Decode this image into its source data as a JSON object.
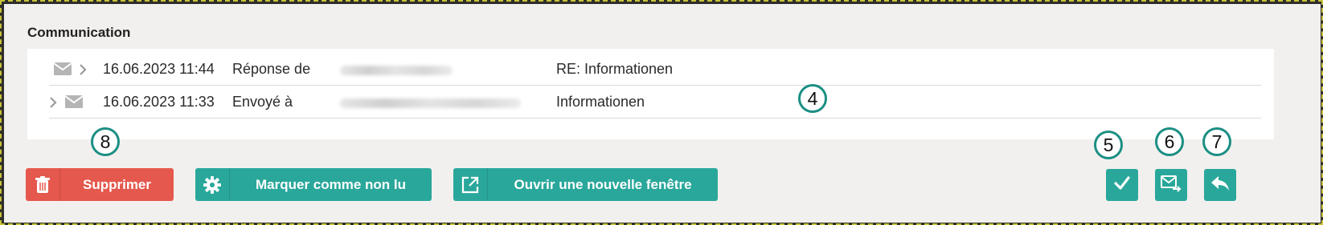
{
  "section_title": "Communication",
  "messages": [
    {
      "direction": "reply",
      "datetime": "16.06.2023 11:44",
      "action": "Réponse de",
      "address": "",
      "subject": "RE: Informationen"
    },
    {
      "direction": "sent",
      "datetime": "16.06.2023 11:33",
      "action": "Envoyé à",
      "address": "",
      "subject": "Informationen"
    }
  ],
  "buttons": {
    "delete_label": "Supprimer",
    "mark_unread_label": "Marquer comme non lu",
    "open_window_label": "Ouvrir une nouvelle fenêtre"
  },
  "annotations": {
    "a4": "4",
    "a5": "5",
    "a6": "6",
    "a7": "7",
    "a8": "8"
  },
  "colors": {
    "accent_teal": "#2aa79b",
    "danger_red": "#e5584d",
    "annotation_ring": "#1b8f84",
    "frame_dash": "#c8c23a"
  },
  "icons": {
    "delete": "trash-icon",
    "mark_unread": "gear-icon",
    "open_window": "external-window-icon",
    "confirm": "checkmark-icon",
    "forward_mail": "mail-forward-icon",
    "reply": "reply-arrow-icon",
    "received": "envelope-icon",
    "expand": "chevron-right-icon"
  }
}
